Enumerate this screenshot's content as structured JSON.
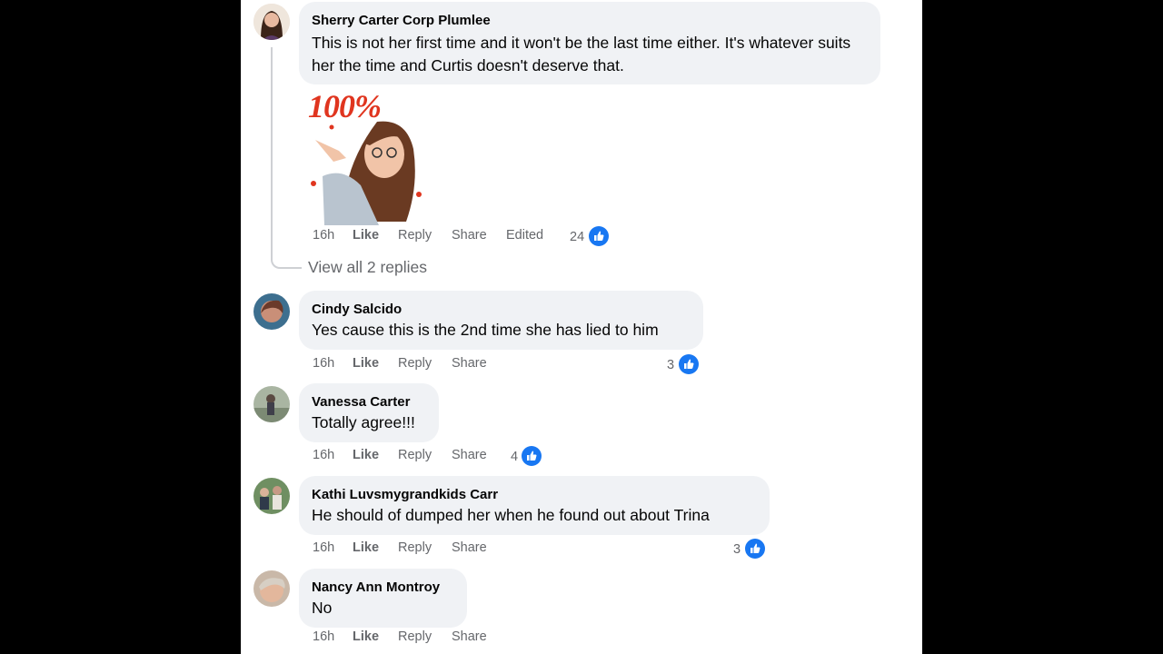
{
  "colors": {
    "background_letterbox": "#000000",
    "panel": "#ffffff",
    "bubble": "#f0f2f5",
    "name_text": "#050505",
    "meta_text": "#65676b",
    "like_blue": "#1877f2"
  },
  "comments": [
    {
      "author": "Sherry Carter Corp Plumlee",
      "text": "This is not her first time and it won't be the last time either. It's whatever suits her the time and Curtis doesn't deserve that.",
      "sticker_text": "100%",
      "time": "16h",
      "like_label": "Like",
      "reply_label": "Reply",
      "share_label": "Share",
      "edited_label": "Edited",
      "likes": "24",
      "view_replies": "View all 2 replies"
    },
    {
      "author": "Cindy Salcido",
      "text": "Yes cause this is the 2nd time she has lied to him",
      "time": "16h",
      "like_label": "Like",
      "reply_label": "Reply",
      "share_label": "Share",
      "likes": "3"
    },
    {
      "author": "Vanessa Carter",
      "text": "Totally agree!!!",
      "time": "16h",
      "like_label": "Like",
      "reply_label": "Reply",
      "share_label": "Share",
      "likes": "4"
    },
    {
      "author": "Kathi Luvsmygrandkids Carr",
      "text": "He should of dumped her when he found out about Trina",
      "time": "16h",
      "like_label": "Like",
      "reply_label": "Reply",
      "share_label": "Share",
      "likes": "3"
    },
    {
      "author": "Nancy Ann Montroy",
      "text": "No",
      "time": "16h",
      "like_label": "Like",
      "reply_label": "Reply",
      "share_label": "Share"
    }
  ]
}
